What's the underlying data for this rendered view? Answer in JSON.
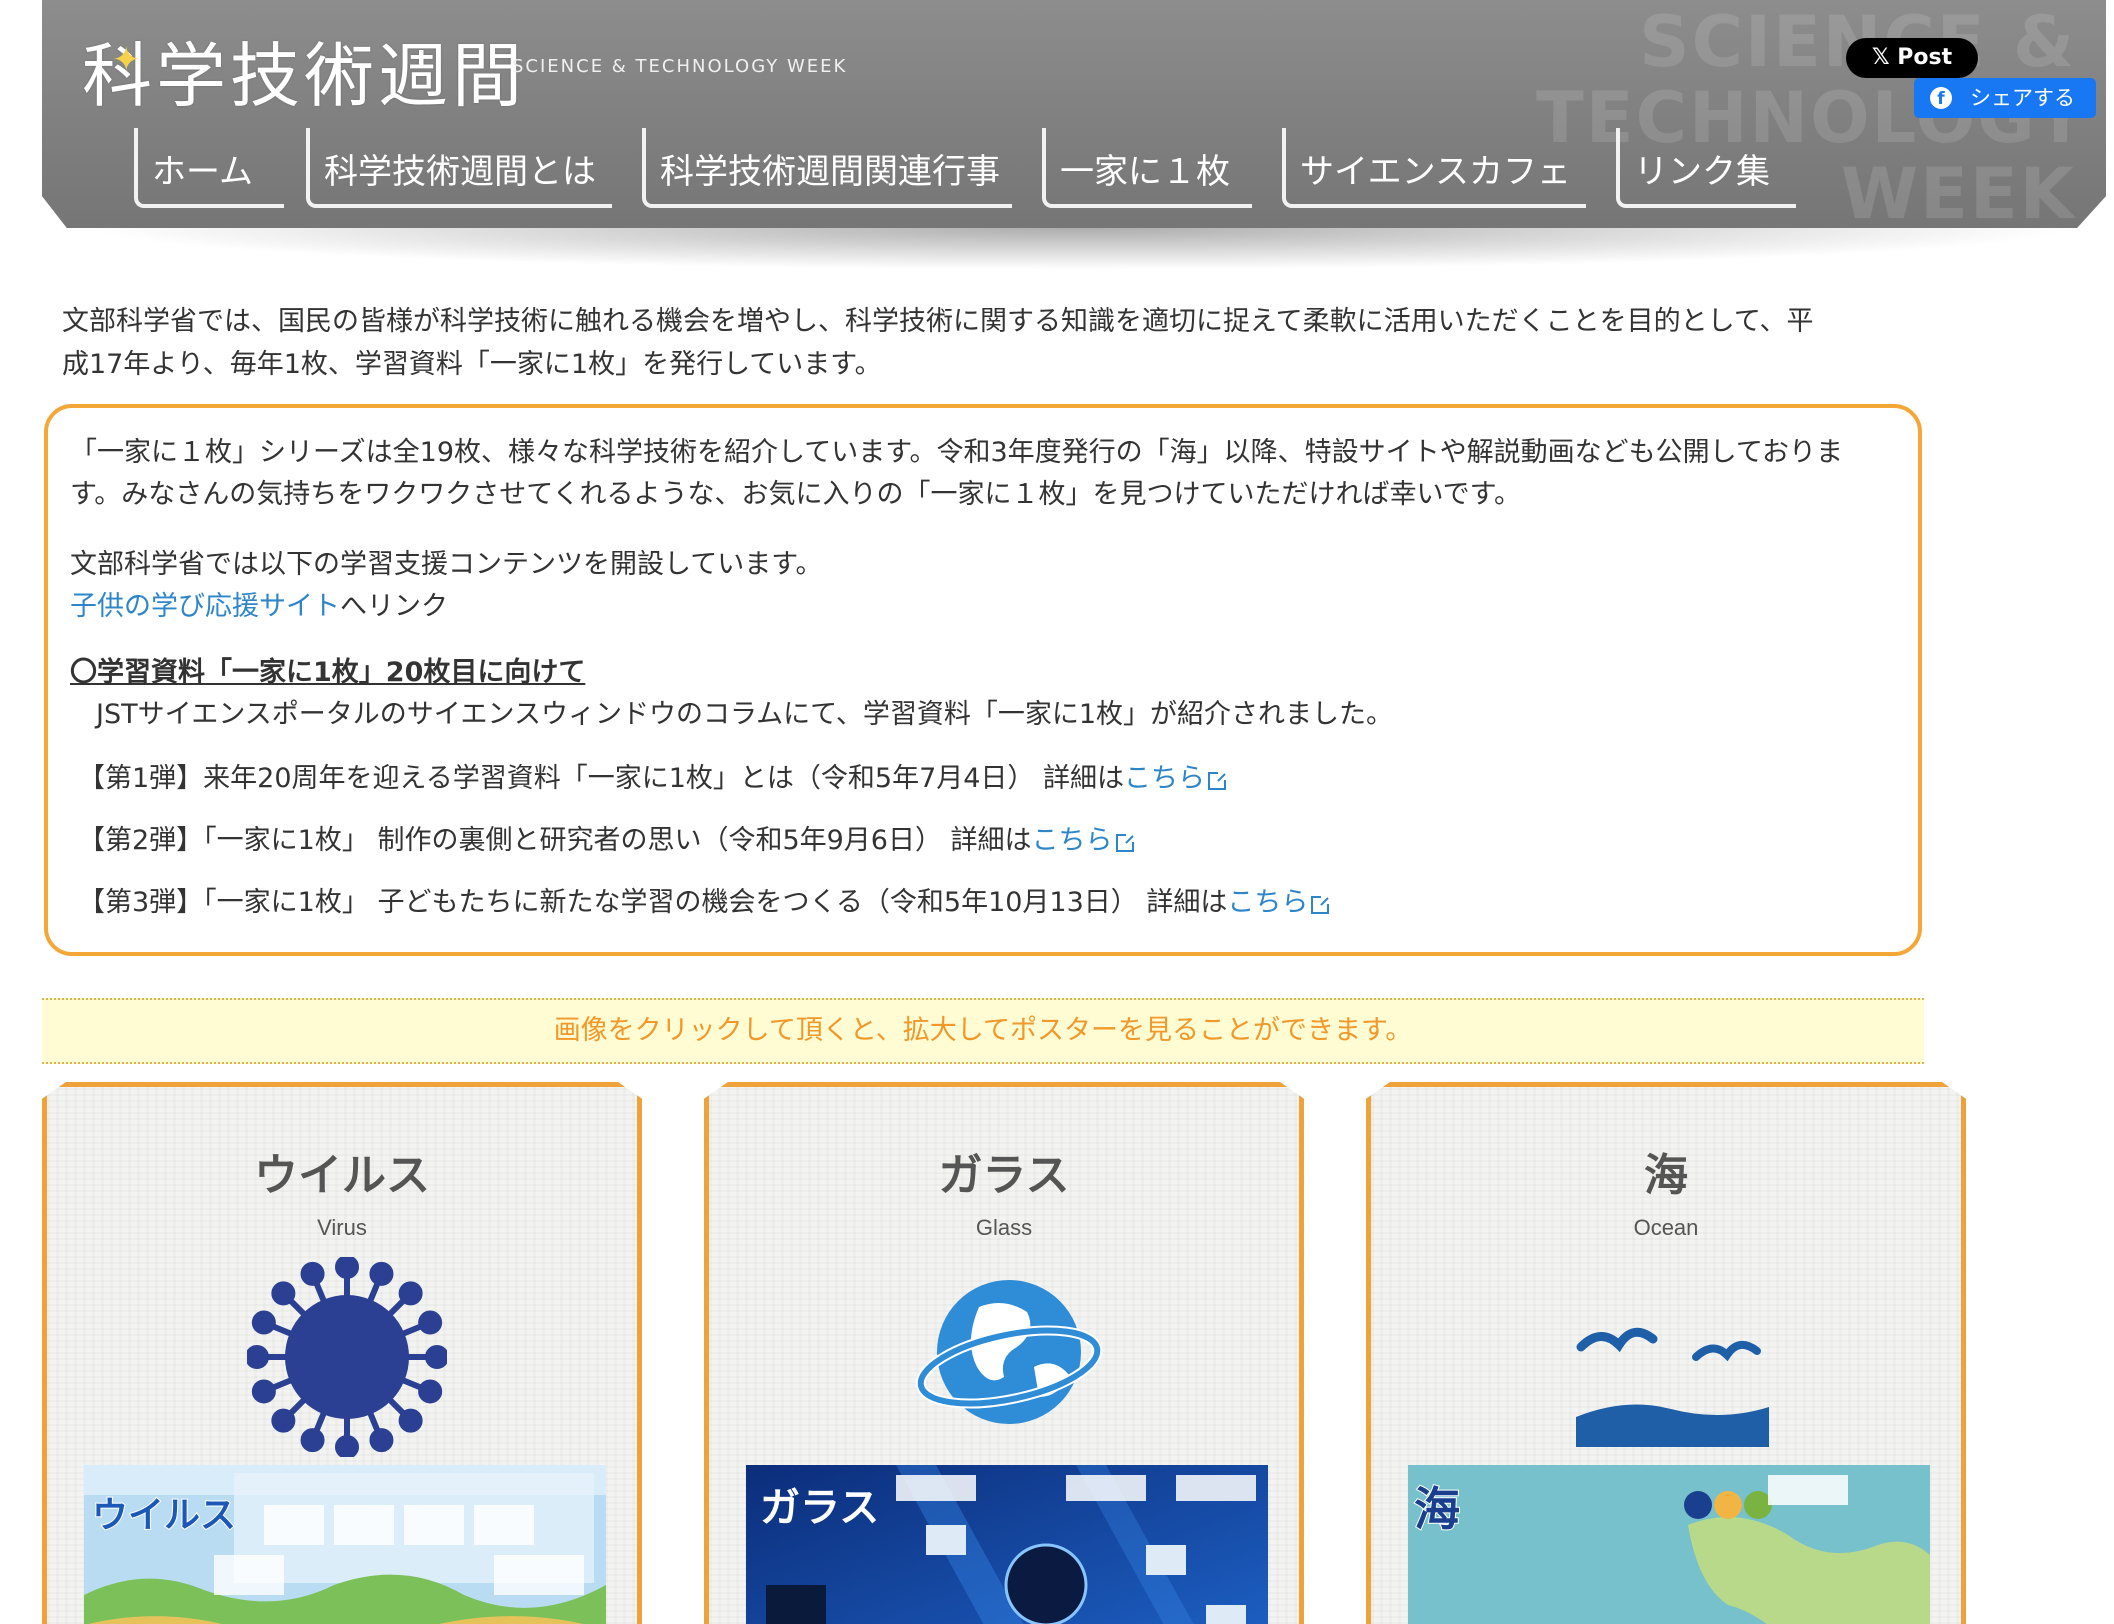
{
  "header": {
    "logo": "科学技術週間",
    "logo_sub": "SCIENCE & TECHNOLOGY WEEK",
    "bg_words": [
      "SCIENCE &",
      "TECHNOLOGY",
      "WEEK"
    ]
  },
  "nav": [
    {
      "label": "ホーム"
    },
    {
      "label": "科学技術週間とは"
    },
    {
      "label": "科学技術週間関連行事"
    },
    {
      "label": "一家に１枚"
    },
    {
      "label": "サイエンスカフェ"
    },
    {
      "label": "リンク集"
    }
  ],
  "social": {
    "x_post": "Post",
    "fb_share": "シェアする"
  },
  "intro": {
    "line1": "文部科学省では、国民の皆様が科学技術に触れる機会を増やし、科学技術に関する知識を適切に捉えて柔軟に活用いただくことを目的として、平",
    "line2": "成17年より、毎年1枚、学習資料「一家に1枚」を発行しています。"
  },
  "info": {
    "p1a": "「一家に１枚」シリーズは全19枚、様々な科学技術を紹介しています。令和3年度発行の「海」以降、特設サイトや解説動画なども公開しておりま",
    "p1b": "す。みなさんの気持ちをワクワクさせてくれるような、お気に入りの「一家に１枚」を見つけていただければ幸いです。",
    "p2": "文部科学省では以下の学習支援コンテンツを開設しています。",
    "kids_link": "子供の学び応援サイト",
    "kids_suffix": "へリンク",
    "heading": "〇学習資料「一家に1枚」20枚目に向けて",
    "jst": "JSTサイエンスポータルのサイエンスウィンドウのコラムにて、学習資料「一家に1枚」が紹介されました。",
    "items": [
      {
        "text": "【第1弾】来年20周年を迎える学習資料「一家に1枚」とは（令和5年7月4日） 詳細は",
        "link": "こちら"
      },
      {
        "text": "【第2弾】「一家に1枚」 制作の裏側と研究者の思い（令和5年9月6日） 詳細は",
        "link": "こちら"
      },
      {
        "text": "【第3弾】「一家に1枚」 子どもたちに新たな学習の機会をつくる（令和5年10月13日） 詳細は",
        "link": "こちら"
      }
    ]
  },
  "notice": "画像をクリックして頂くと、拡大してポスターを見ることができます。",
  "cards": [
    {
      "title": "ウイルス",
      "sub": "Virus",
      "poster_label": "ウイルス"
    },
    {
      "title": "ガラス",
      "sub": "Glass",
      "poster_label": "ガラス"
    },
    {
      "title": "海",
      "sub": "Ocean",
      "poster_label": "海"
    }
  ],
  "colors": {
    "accent_orange": "#f4a736",
    "link_blue": "#2e86c9",
    "notice_bg": "#fffbd2",
    "notice_text": "#f0982a",
    "virus_blue": "#2b3f93",
    "glass_blue": "#2f8cd6",
    "ocean_blue": "#1f5fa8"
  }
}
